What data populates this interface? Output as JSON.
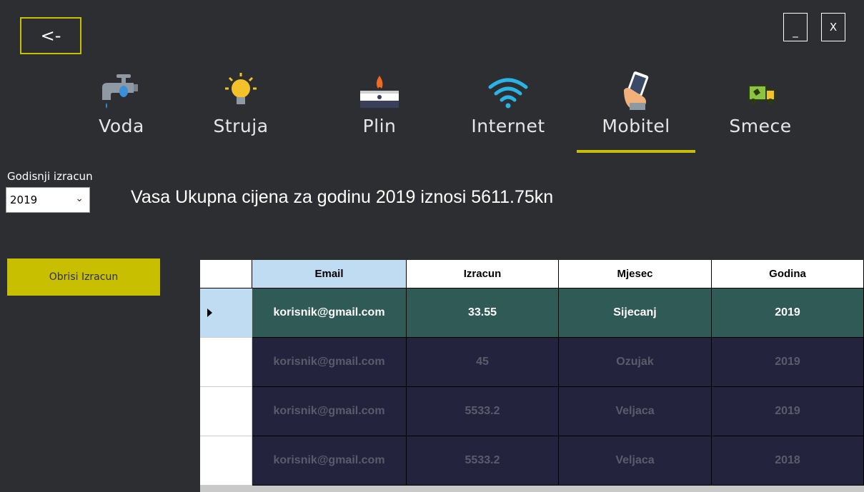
{
  "window": {
    "back_label": "<-",
    "minimize_label": "_",
    "close_label": "X"
  },
  "categories": [
    {
      "label": "Voda",
      "icon": "water-tap-icon"
    },
    {
      "label": "Struja",
      "icon": "light-bulb-icon"
    },
    {
      "label": "Plin",
      "icon": "gas-stove-icon"
    },
    {
      "label": "Internet",
      "icon": "wifi-icon"
    },
    {
      "label": "Mobitel",
      "icon": "mobile-phone-icon",
      "active": true
    },
    {
      "label": "Smece",
      "icon": "garbage-truck-icon"
    }
  ],
  "colors": {
    "accent": "#c8bf00",
    "background": "#2d2e32",
    "row_bg": "#23233e",
    "selected_row_bg": "#2f5a55"
  },
  "filter": {
    "label": "Godisnji izracun",
    "selected_year": "2019"
  },
  "summary": {
    "text": "Vasa Ukupna cijena za godinu 2019 iznosi 5611.75kn"
  },
  "actions": {
    "delete_label": "Obrisi Izracun"
  },
  "table": {
    "headers": [
      "Email",
      "Izracun",
      "Mjesec",
      "Godina"
    ],
    "rows": [
      {
        "email": "korisnik@gmail.com",
        "amount": "33.55",
        "month": "Sijecanj",
        "year": "2019",
        "selected": true
      },
      {
        "email": "korisnik@gmail.com",
        "amount": "45",
        "month": "Ozujak",
        "year": "2019"
      },
      {
        "email": "korisnik@gmail.com",
        "amount": "5533.2",
        "month": "Veljaca",
        "year": "2019"
      },
      {
        "email": "korisnik@gmail.com",
        "amount": "5533.2",
        "month": "Veljaca",
        "year": "2018"
      }
    ]
  }
}
